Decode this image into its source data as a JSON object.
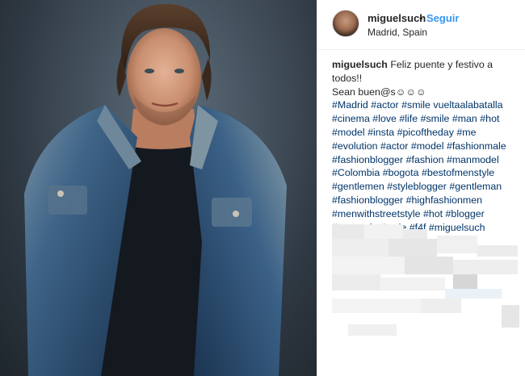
{
  "post": {
    "username": "miguelsuch",
    "separator": "•",
    "follow_label": "Seguir",
    "location": "Madrid, Spain"
  },
  "caption": {
    "username": "miguelsuch",
    "line1": "Feliz puente y festivo a todos!!",
    "line2": "Sean buen@s☺☺☺",
    "hashtags": [
      "#Madrid",
      "#actor",
      "#smile",
      "vueltaalabatalla",
      "#cinema",
      "#love",
      "#life",
      "#smile",
      "#man",
      "#hot",
      "#model",
      "#insta",
      "#picoftheday",
      "#me",
      "#evolution",
      "#actor",
      "#model",
      "#fashionmale",
      "#fashionblogger",
      "#fashion",
      "#manmodel",
      "#Colombia",
      "#bogota",
      "#bestofmenstyle",
      "#gentlemen",
      "#styleblogger",
      "#gentleman",
      "#fashionblogger",
      "#highfashionmen",
      "#menwithstreetstyle",
      "#hot",
      "#blogger",
      "#manstyle",
      "#style",
      "#f4f",
      "#miguelsuch"
    ]
  },
  "colors": {
    "link": "#003569",
    "follow": "#3897f0",
    "text": "#262626"
  },
  "icons": {
    "avatar": "profile-photo"
  }
}
